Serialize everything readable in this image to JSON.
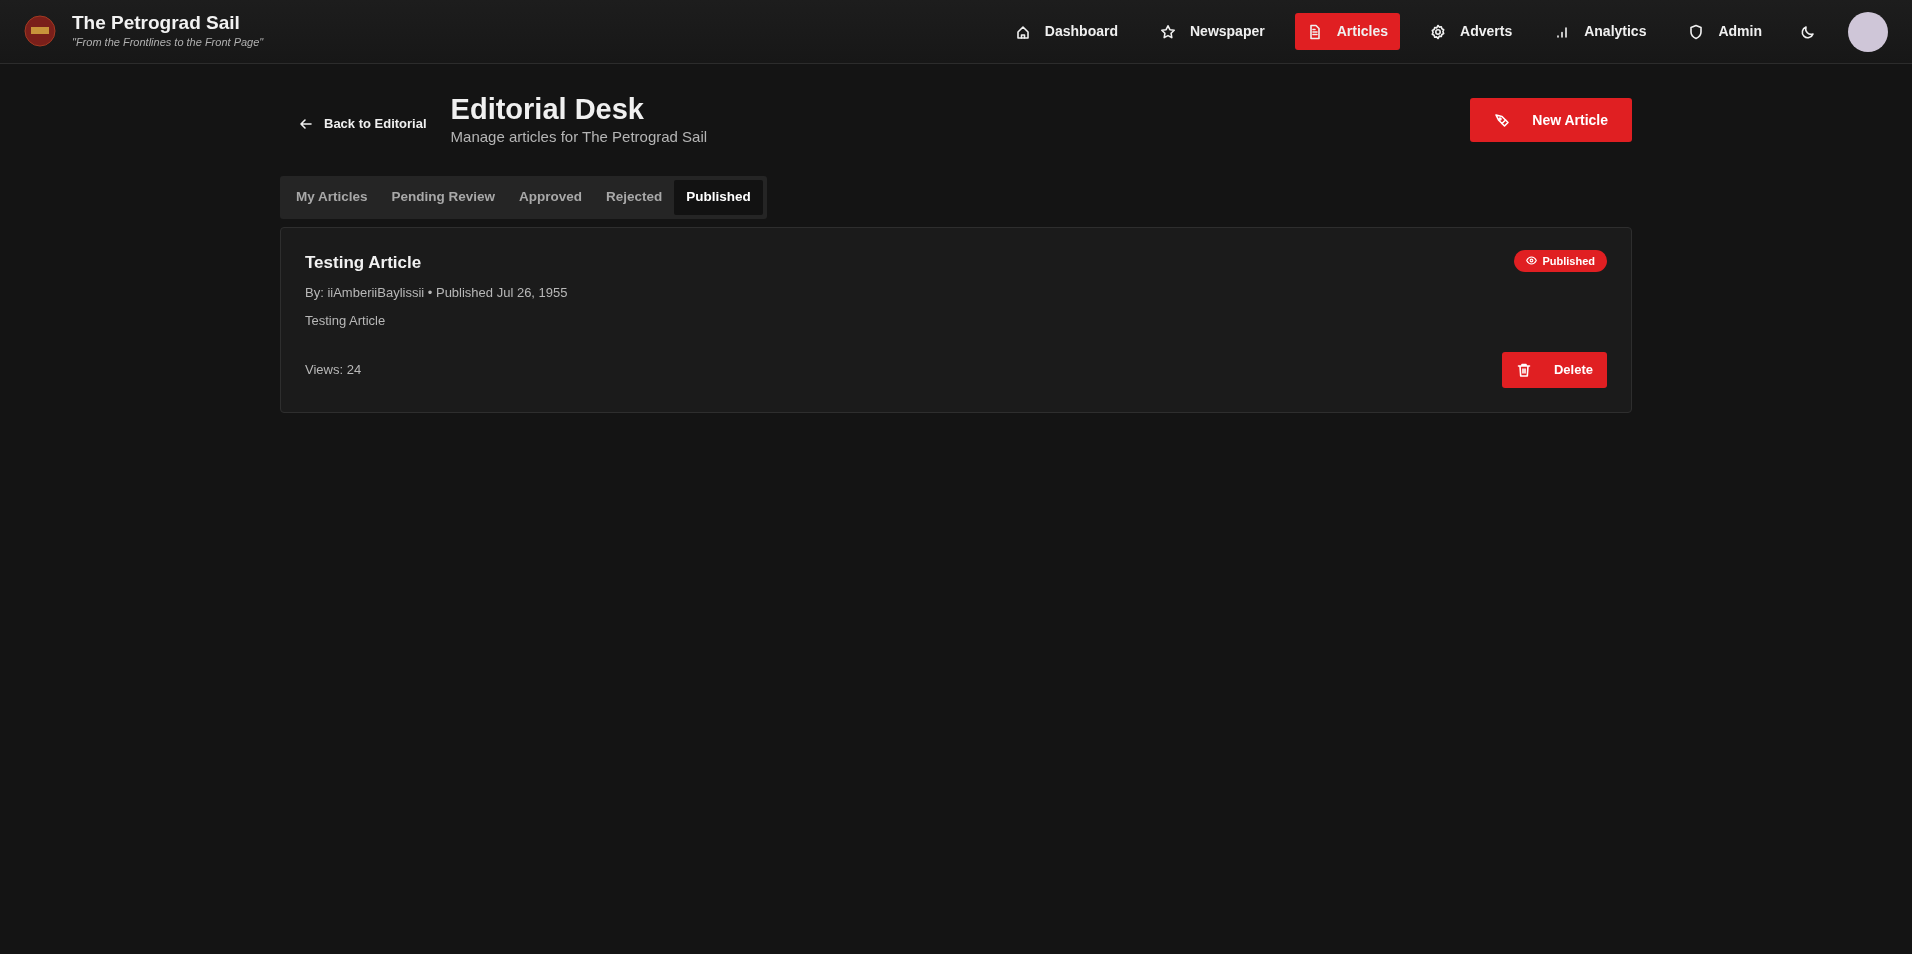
{
  "brand": {
    "title": "The Petrograd Sail",
    "tagline": "\"From the Frontlines to the Front Page\""
  },
  "nav": [
    {
      "label": "Dashboard",
      "selected": false
    },
    {
      "label": "Newspaper",
      "selected": false
    },
    {
      "label": "Articles",
      "selected": true
    },
    {
      "label": "Adverts",
      "selected": false
    },
    {
      "label": "Analytics",
      "selected": false
    },
    {
      "label": "Admin",
      "selected": false
    }
  ],
  "header": {
    "back_link": "Back to Editorial",
    "title": "Editorial Desk",
    "subtitle": "Manage articles for The Petrograd Sail",
    "new_button": "New Article"
  },
  "tabs": [
    {
      "label": "My Articles",
      "selected": false
    },
    {
      "label": "Pending Review",
      "selected": false
    },
    {
      "label": "Approved",
      "selected": false
    },
    {
      "label": "Rejected",
      "selected": false
    },
    {
      "label": "Published",
      "selected": true
    }
  ],
  "articles": [
    {
      "title": "Testing Article",
      "meta": "By: iiAmberiiBaylissii • Published Jul 26, 1955",
      "summary": "Testing Article",
      "status": "Published",
      "views": "Views: 24",
      "delete_button": "Delete"
    }
  ]
}
